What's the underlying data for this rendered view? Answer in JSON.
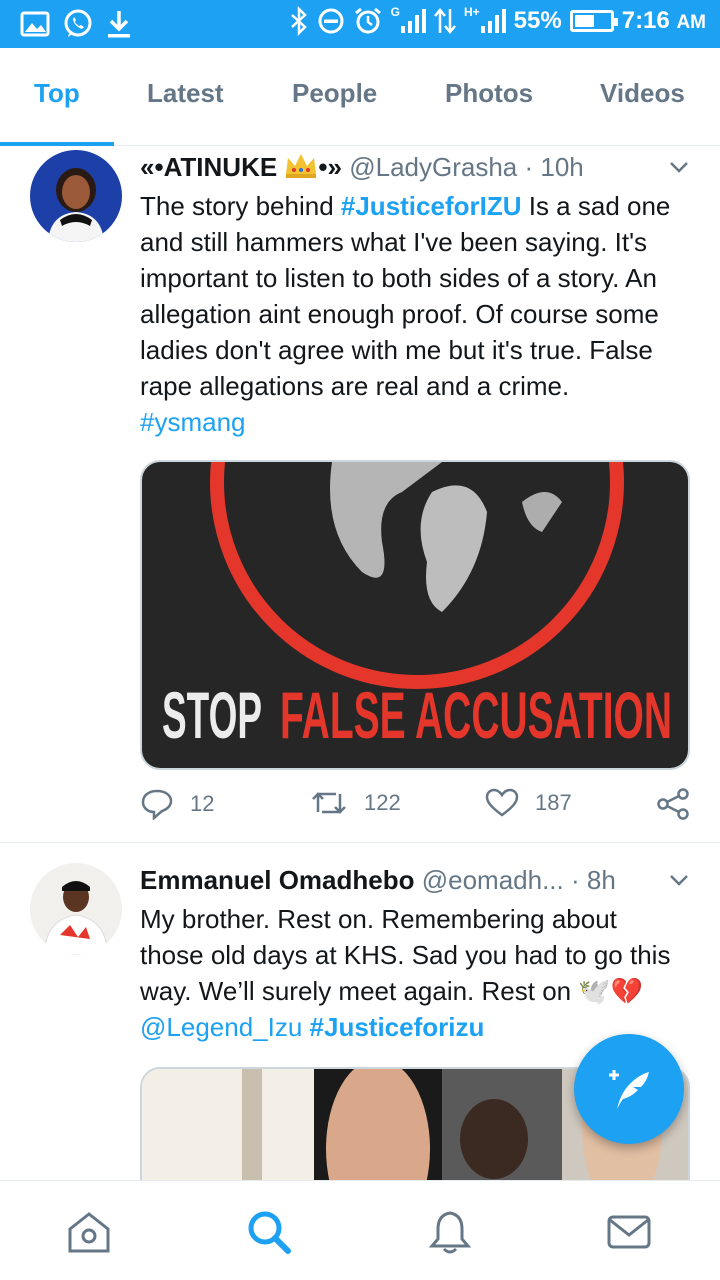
{
  "status_bar": {
    "battery_percent_label": "55%",
    "battery_level": 0.55,
    "time": "7:16",
    "ampm": "AM",
    "network_h": "H+",
    "network_g": "G",
    "left_icons": [
      "gallery-icon",
      "whatsapp-icon",
      "download-icon"
    ],
    "right_icons": [
      "bluetooth-icon",
      "do-not-disturb-icon",
      "alarm-icon",
      "signal-icon",
      "data-arrows-icon",
      "signal-icon"
    ]
  },
  "tabs": [
    {
      "label": "Top",
      "active": true
    },
    {
      "label": "Latest",
      "active": false
    },
    {
      "label": "People",
      "active": false
    },
    {
      "label": "Photos",
      "active": false
    },
    {
      "label": "Videos",
      "active": false
    }
  ],
  "tweets": [
    {
      "name_prefix": "«•ATINUKE ",
      "name_suffix": "•»",
      "handle": "@LadyGrasha",
      "time": "10h",
      "text_parts": {
        "t1": "The story behind ",
        "h1": "#JusticeforIZU",
        "t2": " Is a  sad one and still hammers what I've been saying. It's important to listen to both sides of a story. An allegation aint enough proof. Of course some ladies don't agree with me but it's true. False rape allegations are real and a crime. ",
        "h2": "#ysmang"
      },
      "media_word_1": "STOP",
      "media_word_2": "FALSE ACCUSATION",
      "replies": "12",
      "retweets": "122",
      "likes": "187"
    },
    {
      "name": "Emmanuel Omadhebo",
      "handle": "@eomadh...",
      "time": "8h",
      "text_parts": {
        "t1": "My brother. Rest on. Remembering about those old days at KHS. Sad you had to go this way. We’ll surely meet again. Rest on ",
        "emoji": "🕊️💔",
        "m1": "@Legend_Izu",
        "h1": "#Justiceforizu"
      }
    }
  ],
  "bottom_nav": [
    "home-icon",
    "search-icon",
    "notifications-icon",
    "messages-icon"
  ],
  "colors": {
    "brand": "#1da1f2",
    "text": "#14171a",
    "muted": "#657786",
    "accent_red": "#e5362b"
  }
}
